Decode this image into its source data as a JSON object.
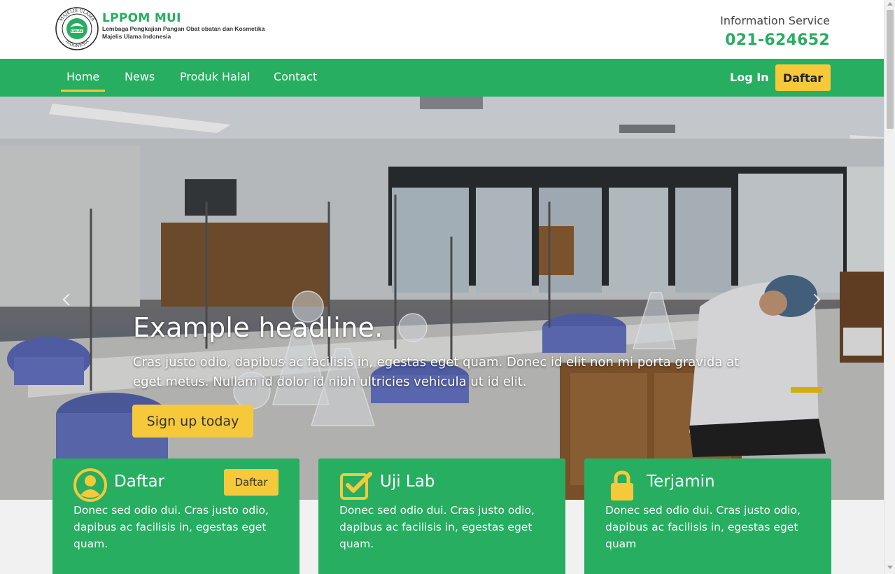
{
  "header": {
    "logo_title": "LPPOM MUI",
    "logo_sub_1": "Lembaga Pengkajian Pangan Obat obatan dan Kosmetika",
    "logo_sub_2": "Majelis Ulama Indonesia",
    "seal_icon": "mui-halal-seal-icon",
    "seal_text": "MAJELIS ULAMA INDONESIA HALAL",
    "info_label": "Information Service",
    "info_phone": "021-624652"
  },
  "nav": {
    "items": [
      {
        "label": "Home",
        "active": true
      },
      {
        "label": "News",
        "active": false
      },
      {
        "label": "Produk Halal",
        "active": false
      },
      {
        "label": "Contact",
        "active": false
      }
    ],
    "login": "Log In",
    "daftar": "Daftar"
  },
  "hero": {
    "headline": "Example headline.",
    "lead": "Cras justo odio, dapibus ac facilisis in, egestas eget quam. Donec id elit non mi porta gravida at eget metus. Nullam id dolor id nibh ultricies vehicula ut id elit.",
    "cta": "Sign up today",
    "prev_icon": "chevron-left-icon",
    "next_icon": "chevron-right-icon"
  },
  "cards": [
    {
      "title": "Daftar",
      "body": "Donec sed odio dui. Cras justo odio, dapibus ac facilisis in, egestas eget quam.",
      "icon": "user-icon",
      "button": "Daftar"
    },
    {
      "title": "Uji Lab",
      "body": "Donec sed odio dui. Cras justo odio, dapibus ac facilisis in, egestas eget quam.",
      "icon": "checkbox-icon"
    },
    {
      "title": "Terjamin",
      "body": "Donec sed odio dui. Cras justo odio, dapibus ac facilisis in, egestas eget quam",
      "icon": "lock-icon"
    }
  ],
  "colors": {
    "brand_green": "#27ae60",
    "accent_yellow": "#f5c93a"
  }
}
